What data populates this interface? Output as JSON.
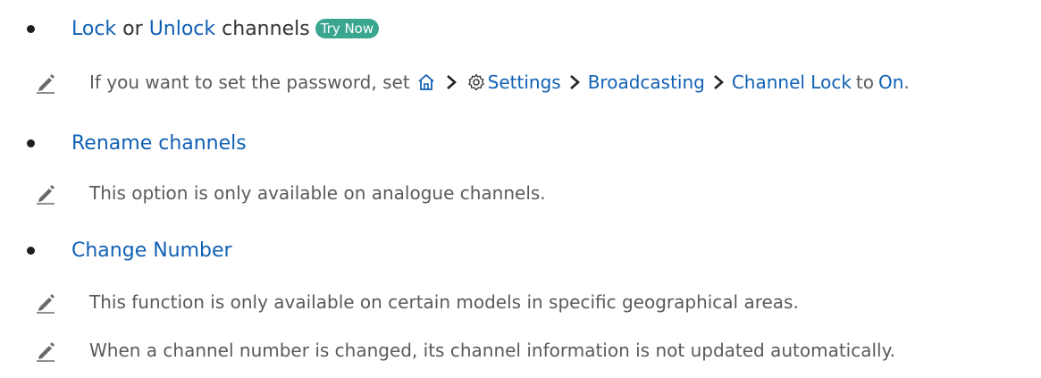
{
  "items": [
    {
      "lock_link": "Lock",
      "or_text": "or",
      "unlock_link": "Unlock",
      "tail_text": "channels",
      "try_now": "Try Now",
      "note": {
        "prefix": "If you want to set the password, set",
        "settings_link": "Settings",
        "broadcasting_link": "Broadcasting",
        "channel_lock_link": "Channel Lock",
        "to_text": "to",
        "on_link": "On",
        "end_punct": "."
      }
    },
    {
      "label": "Rename channels",
      "notes": [
        "This option is only available on analogue channels."
      ]
    },
    {
      "label": "Change Number",
      "notes": [
        "This function is only available on certain models in specific geographical areas.",
        "When a channel number is changed, its channel information is not updated automatically."
      ]
    }
  ],
  "icons": {
    "note": "pencil-note-icon",
    "home": "home-icon",
    "settings": "gear-icon",
    "chevron": "chevron-right-icon"
  },
  "colors": {
    "link": "#1060b4",
    "try_now_badge": "#3aa68f",
    "body_text": "#333333",
    "note_text": "#5a5a5a"
  }
}
